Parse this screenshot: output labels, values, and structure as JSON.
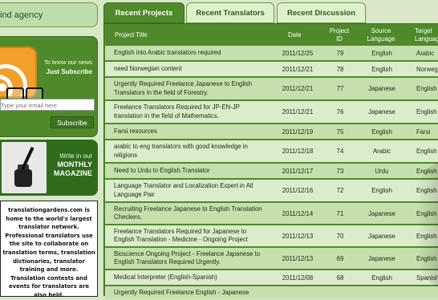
{
  "agency_box": {
    "text": "ind agency"
  },
  "rss_box": {
    "line1": "To know our news",
    "line2": "Just Subscribe",
    "email_placeholder": "Type your email here",
    "subscribe_label": "Subscribe"
  },
  "magazine_box": {
    "line1": "Write in our",
    "line2": "MONTHLY",
    "line3": "MAGAZINE"
  },
  "about_text": "translationgardens.com is home to the world's largest translator network. Professional translators use the site to collaborate on translation terms, translation dictionaries, translator training and more. Translation contests and events for translators are also held.",
  "tabs": {
    "recent_projects": "Recent Projects",
    "recent_translators": "Recent Translators",
    "recent_discussion": "Recent Discussion"
  },
  "table": {
    "headers": {
      "title": "Project Title",
      "date": "Date",
      "project_id": "Project ID",
      "source": "Source Language",
      "target": "Target Language"
    },
    "rows": [
      {
        "title": "English into Arabic translators required",
        "date": "2011/12/25",
        "id": "79",
        "source": "English",
        "target": "Arabic"
      },
      {
        "title": "need Norwegian content",
        "date": "2011/12/21",
        "id": "78",
        "source": "English",
        "target": "Norwegian"
      },
      {
        "title": "Urgently Required Freelance Japanese to English Translators in the field of Forestry.",
        "date": "2011/12/21",
        "id": "77",
        "source": "Japanese",
        "target": "English"
      },
      {
        "title": "Freelance Translators Required for JP-EN-JP translation in the field of Mathematics.",
        "date": "2011/12/21",
        "id": "76",
        "source": "Japanese",
        "target": "English"
      },
      {
        "title": "Farsi resources",
        "date": "2011/12/19",
        "id": "75",
        "source": "English",
        "target": "Farsi"
      },
      {
        "title": "arabic to eng translators with good knowledge in religions",
        "date": "2011/12/18",
        "id": "74",
        "source": "Arabic",
        "target": "English"
      },
      {
        "title": "Need to Urdu to English Translator",
        "date": "2011/12/17",
        "id": "73",
        "source": "Urdu",
        "target": "English"
      },
      {
        "title": "Language Translator and Localization Expert in All Language Pair",
        "date": "2011/12/16",
        "id": "72",
        "source": "English",
        "target": "English"
      },
      {
        "title": "Recruiting Freelance Japanese to English Translation Checkers.",
        "date": "2011/12/14",
        "id": "71",
        "source": "Japanese",
        "target": "English"
      },
      {
        "title": "Freelance Translators Required for Japanese to English Translation - Medicine - Ongoing Project",
        "date": "2011/12/13",
        "id": "70",
        "source": "Japanese",
        "target": "English"
      },
      {
        "title": "Bioscience Ongoing Project - Freelance Japanese to English Translators Required Urgently.",
        "date": "2011/12/13",
        "id": "69",
        "source": "Japanese",
        "target": "English"
      },
      {
        "title": "Medical Interpreter (English-Spanish)",
        "date": "2011/12/08",
        "id": "68",
        "source": "English",
        "target": "Spanish"
      },
      {
        "title": "Urgently Required Freelance English - Japanese",
        "date": "",
        "id": "",
        "source": "",
        "target": ""
      }
    ]
  },
  "colors": {
    "panel_green": "#4f8a2a",
    "row_light": "#dbeccb",
    "row_mid": "#c6e0ad"
  }
}
